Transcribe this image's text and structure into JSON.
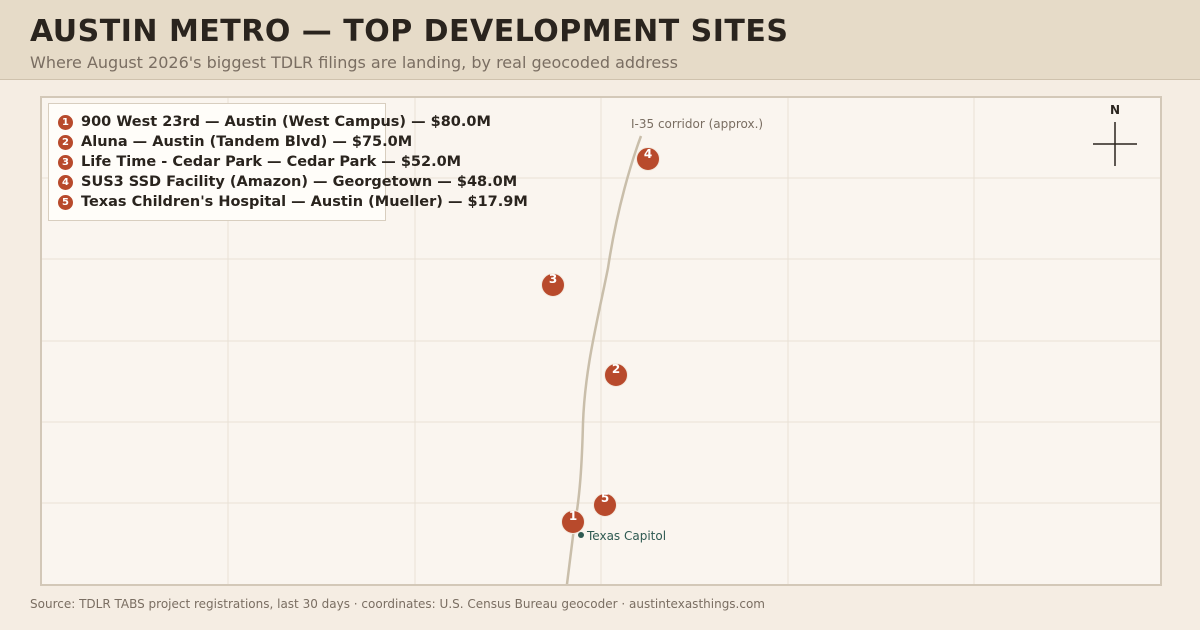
{
  "header": {
    "title": "AUSTIN METRO — TOP DEVELOPMENT SITES",
    "subtitle": "Where August 2026's biggest TDLR filings are landing, by real geocoded address"
  },
  "legend": {
    "items": [
      {
        "number": "1",
        "label": "900 West 23rd — Austin (West Campus) — $80.0M"
      },
      {
        "number": "2",
        "label": "Aluna — Austin (Tandem Blvd) — $75.0M"
      },
      {
        "number": "3",
        "label": "Life Time - Cedar Park — Cedar Park — $52.0M"
      },
      {
        "number": "4",
        "label": "SUS3 SSD Facility (Amazon) — Georgetown — $48.0M"
      },
      {
        "number": "5",
        "label": "Texas Children's Hospital — Austin (Mueller) — $17.9M"
      }
    ]
  },
  "map": {
    "corridor_label": "I-35 corridor (approx.)",
    "landmark_label": "Texas Capitol",
    "north_label": "N",
    "colors": {
      "marker": "#b84a2c",
      "landmark": "#2f5a52",
      "corridor": "#c9beaa",
      "grid": "#e9e1d6"
    }
  },
  "footer": {
    "source": "Source: TDLR TABS project registrations, last 30 days · coordinates: U.S. Census Bureau geocoder · austintexasthings.com"
  }
}
